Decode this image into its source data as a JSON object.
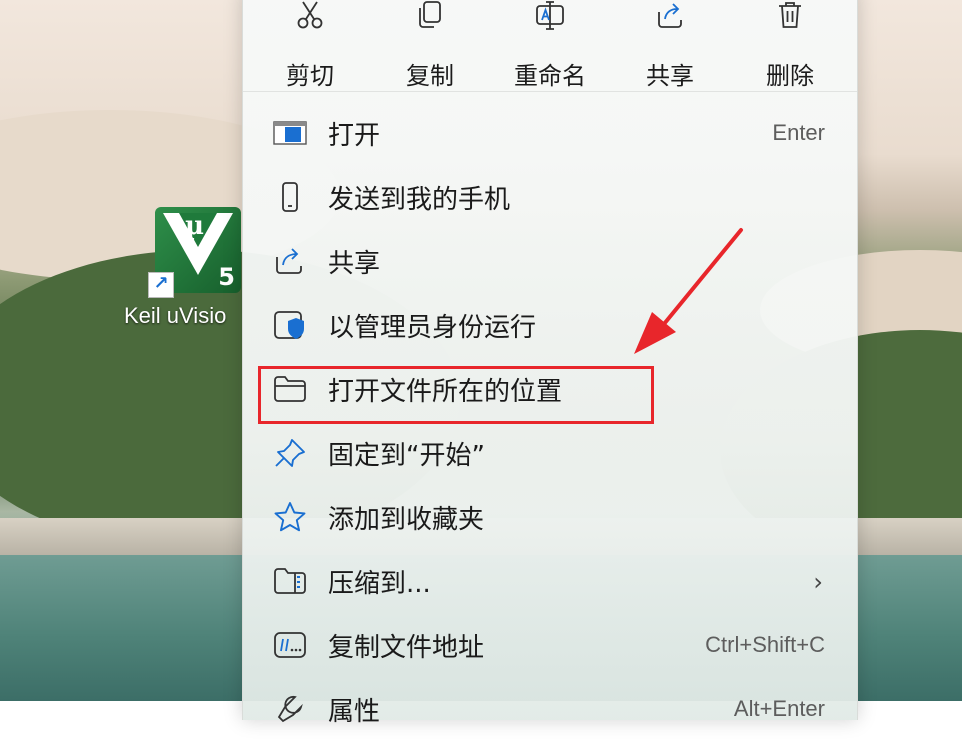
{
  "desktop": {
    "shortcut_label": "Keil uVisio",
    "app_icon_glyphs": {
      "mu": "µ",
      "version": "5"
    }
  },
  "toolbar": [
    {
      "label": "剪切",
      "icon": "cut-icon"
    },
    {
      "label": "复制",
      "icon": "copy-icon"
    },
    {
      "label": "重命名",
      "icon": "rename-icon"
    },
    {
      "label": "共享",
      "icon": "share-icon"
    },
    {
      "label": "删除",
      "icon": "delete-icon"
    }
  ],
  "menu_items": [
    {
      "label": "打开",
      "shortcut": "Enter",
      "icon": "open-app-icon"
    },
    {
      "label": "发送到我的手机",
      "shortcut": "",
      "icon": "phone-icon"
    },
    {
      "label": "共享",
      "shortcut": "",
      "icon": "share-icon"
    },
    {
      "label": "以管理员身份运行",
      "shortcut": "",
      "icon": "shield-icon"
    },
    {
      "label": "打开文件所在的位置",
      "shortcut": "",
      "icon": "folder-icon"
    },
    {
      "label": "固定到“开始”",
      "shortcut": "",
      "icon": "pin-icon"
    },
    {
      "label": "添加到收藏夹",
      "shortcut": "",
      "icon": "star-icon"
    },
    {
      "label": "压缩到...",
      "shortcut": "",
      "icon": "zip-icon",
      "submenu": true
    },
    {
      "label": "复制文件地址",
      "shortcut": "Ctrl+Shift+C",
      "icon": "copy-path-icon"
    },
    {
      "label": "属性",
      "shortcut": "Alt+Enter",
      "icon": "properties-icon"
    }
  ],
  "annotation": {
    "highlight_color": "#e8262b",
    "highlighted_item": "打开文件所在的位置"
  },
  "colors": {
    "accent": "#1a6fd1",
    "annotation_red": "#e8262b"
  }
}
